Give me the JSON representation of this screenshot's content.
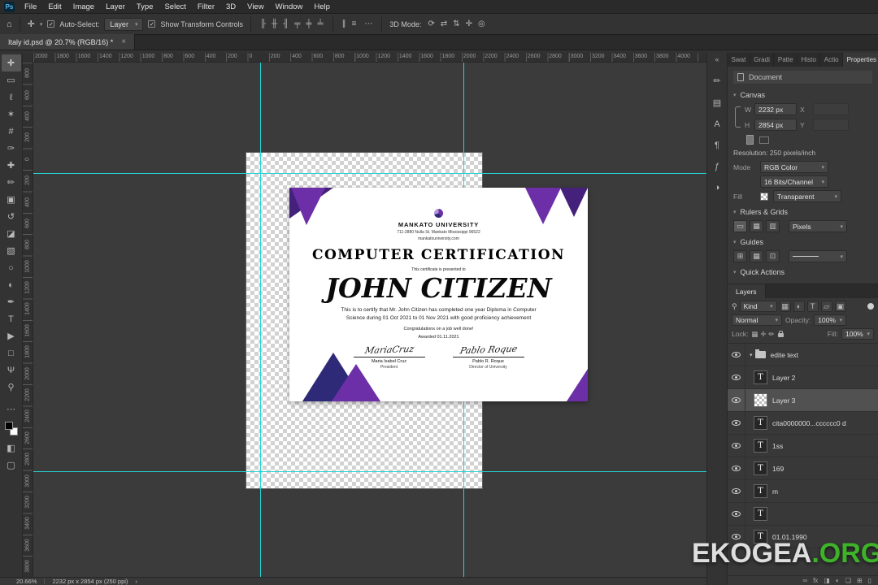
{
  "ui_colors": {
    "guide": "#27d3d3",
    "watermark_green": "#3eb229"
  },
  "app": {
    "badge": "Ps",
    "menu": [
      "File",
      "Edit",
      "Image",
      "Layer",
      "Type",
      "Select",
      "Filter",
      "3D",
      "View",
      "Window",
      "Help"
    ],
    "tab_title": "Italy id.psd @ 20.7% (RGB/16) *",
    "tab_close": "×"
  },
  "options": {
    "home_icon": "⌂",
    "tool_icon": "✛",
    "auto_select_label": "Auto-Select:",
    "auto_select_value": "Layer",
    "transform_label": "Show Transform Controls",
    "align_icons": [
      "╟",
      "╫",
      "╢",
      "╤",
      "╪",
      "╧"
    ],
    "distribute_icons": [
      "∥",
      "≡"
    ],
    "more_icon": "⋯",
    "mode3d_label": "3D Mode:",
    "mode3d_icons": [
      "⟳",
      "⇄",
      "⇅",
      "✛",
      "◎"
    ]
  },
  "toolbar": {
    "tools": [
      {
        "name": "move-tool",
        "glyph": "✛",
        "active": true
      },
      {
        "name": "marquee-tool",
        "glyph": "▭"
      },
      {
        "name": "lasso-tool",
        "glyph": "ℓ"
      },
      {
        "name": "magic-wand-tool",
        "glyph": "✶"
      },
      {
        "name": "crop-tool",
        "glyph": "#"
      },
      {
        "name": "eyedropper-tool",
        "glyph": "✑"
      },
      {
        "name": "healing-brush-tool",
        "glyph": "✚"
      },
      {
        "name": "brush-tool",
        "glyph": "✏"
      },
      {
        "name": "clone-stamp-tool",
        "glyph": "▣"
      },
      {
        "name": "history-brush-tool",
        "glyph": "↺"
      },
      {
        "name": "eraser-tool",
        "glyph": "◪"
      },
      {
        "name": "gradient-tool",
        "glyph": "▧"
      },
      {
        "name": "blur-tool",
        "glyph": "○"
      },
      {
        "name": "dodge-tool",
        "glyph": "◐"
      },
      {
        "name": "pen-tool",
        "glyph": "✒"
      },
      {
        "name": "type-tool",
        "glyph": "T"
      },
      {
        "name": "path-select-tool",
        "glyph": "▶"
      },
      {
        "name": "shape-tool",
        "glyph": "□"
      },
      {
        "name": "hand-tool",
        "glyph": "Ψ"
      },
      {
        "name": "zoom-tool",
        "glyph": "⚲"
      }
    ],
    "more_icon": "⋯",
    "mask_icon": "◧",
    "screen_icon": "▢"
  },
  "rulers": {
    "top": [
      "2000",
      "1800",
      "1600",
      "1400",
      "1200",
      "1000",
      "800",
      "600",
      "400",
      "200",
      "0",
      "200",
      "400",
      "600",
      "800",
      "1000",
      "1200",
      "1400",
      "1600",
      "1800",
      "2000",
      "2200",
      "2400",
      "2600",
      "2800",
      "3000",
      "3200",
      "3400",
      "3600",
      "3800",
      "4000"
    ],
    "left": [
      "800",
      "600",
      "400",
      "200",
      "0",
      "200",
      "400",
      "600",
      "800",
      "1000",
      "1200",
      "1400",
      "1600",
      "1800",
      "2000",
      "2200",
      "2400",
      "2600",
      "2800",
      "3000",
      "3200",
      "3400",
      "3600",
      "3800"
    ]
  },
  "dock_strip": {
    "collapse_icon": "«",
    "icons": [
      {
        "name": "brush-settings-icon",
        "glyph": "✏"
      },
      {
        "name": "swatches-icon",
        "glyph": "▤"
      },
      {
        "name": "character-icon",
        "glyph": "A"
      },
      {
        "name": "paragraph-icon",
        "glyph": "¶"
      },
      {
        "name": "glyphs-icon",
        "glyph": "ƒ"
      },
      {
        "name": "adjustments-icon",
        "glyph": "◑"
      }
    ]
  },
  "properties": {
    "tabs": [
      "Swat",
      "Gradi",
      "Patte",
      "Histo",
      "Actio",
      "Properties"
    ],
    "active_tab": "Properties",
    "menu_icon": "≡",
    "document_label": "Document",
    "canvas_label": "Canvas",
    "w_label": "W",
    "w_value": "2232 px",
    "x_label": "X",
    "h_label": "H",
    "h_value": "2854 px",
    "y_label": "Y",
    "resolution_text": "Resolution: 250 pixels/inch",
    "mode_label": "Mode",
    "mode_value": "RGB Color",
    "bits_value": "16 Bits/Channel",
    "fill_label": "Fill",
    "fill_value": "Transparent",
    "rulers_grids_label": "Rulers & Grids",
    "ruler_icons": [
      "▭",
      "▦",
      "▥"
    ],
    "units_value": "Pixels",
    "guides_label": "Guides",
    "guide_icons": [
      "⊞",
      "▦",
      "⊡"
    ],
    "quick_actions_label": "Quick Actions"
  },
  "layers_panel": {
    "title": "Layers",
    "search_icon": "⚲",
    "kind_value": "Kind",
    "filter_icons": [
      "▦",
      "◐",
      "T",
      "▱",
      "▣"
    ],
    "blend_value": "Normal",
    "opacity_label": "Opacity:",
    "opacity_value": "100%",
    "lock_label": "Lock:",
    "lock_icons": [
      "▦",
      "✛",
      "✏"
    ],
    "fill_label": "Fill:",
    "fill_value": "100%",
    "rows": [
      {
        "name": "edite text",
        "kind": "group",
        "selected": false
      },
      {
        "name": "Layer 2",
        "kind": "text",
        "selected": false
      },
      {
        "name": "Layer 3",
        "kind": "pixel",
        "selected": true
      },
      {
        "name": "cita0000000...cccccc0 d",
        "kind": "text",
        "selected": false
      },
      {
        "name": "1ss",
        "kind": "text",
        "selected": false
      },
      {
        "name": "169",
        "kind": "text",
        "selected": false
      },
      {
        "name": "m",
        "kind": "text",
        "selected": false
      },
      {
        "name": "",
        "kind": "text",
        "selected": false
      },
      {
        "name": "01.01.1990",
        "kind": "text",
        "selected": false
      }
    ],
    "bottom_icons": [
      "∞",
      "fx",
      "◨",
      "◐",
      "❏",
      "⊞",
      "▯"
    ]
  },
  "certificate": {
    "colors": {
      "purple": "#6c2fa8",
      "dark_purple": "#44217a",
      "navy": "#2e2a78"
    },
    "university": "MANKATO UNIVERSITY",
    "address": "711-2880 Nulla St. Mankato Mississippi 96522",
    "website": "mankatouniversity.com",
    "title": "COMPUTER CERTIFICATION",
    "presented": "This certificate is presented to",
    "name": "JOHN CITIZEN",
    "body_line1": "This is to certify that Mr. John Citizen has completed one year Diploma in Computer",
    "body_line2": "Science during 01 Oct 2021 to 01 Nov 2021 with good proficiency achievement",
    "congrats": "Congratulations on a job well done!",
    "awarded": "Awarded 01.11.2021",
    "sig1_script": "MariaCruz",
    "sig1_name": "Maria Isabel Cruz",
    "sig1_title": "President",
    "sig2_script": "Pablo Roque",
    "sig2_name": "Pablo R. Roque",
    "sig2_title": "Director of University"
  },
  "statusbar": {
    "zoom": "20.66%",
    "doc_info": "2232 px x 2854 px (250 ppi)",
    "chevron": "›"
  },
  "watermark": {
    "brand": "EKOGEA",
    "tld": ".ORG"
  }
}
